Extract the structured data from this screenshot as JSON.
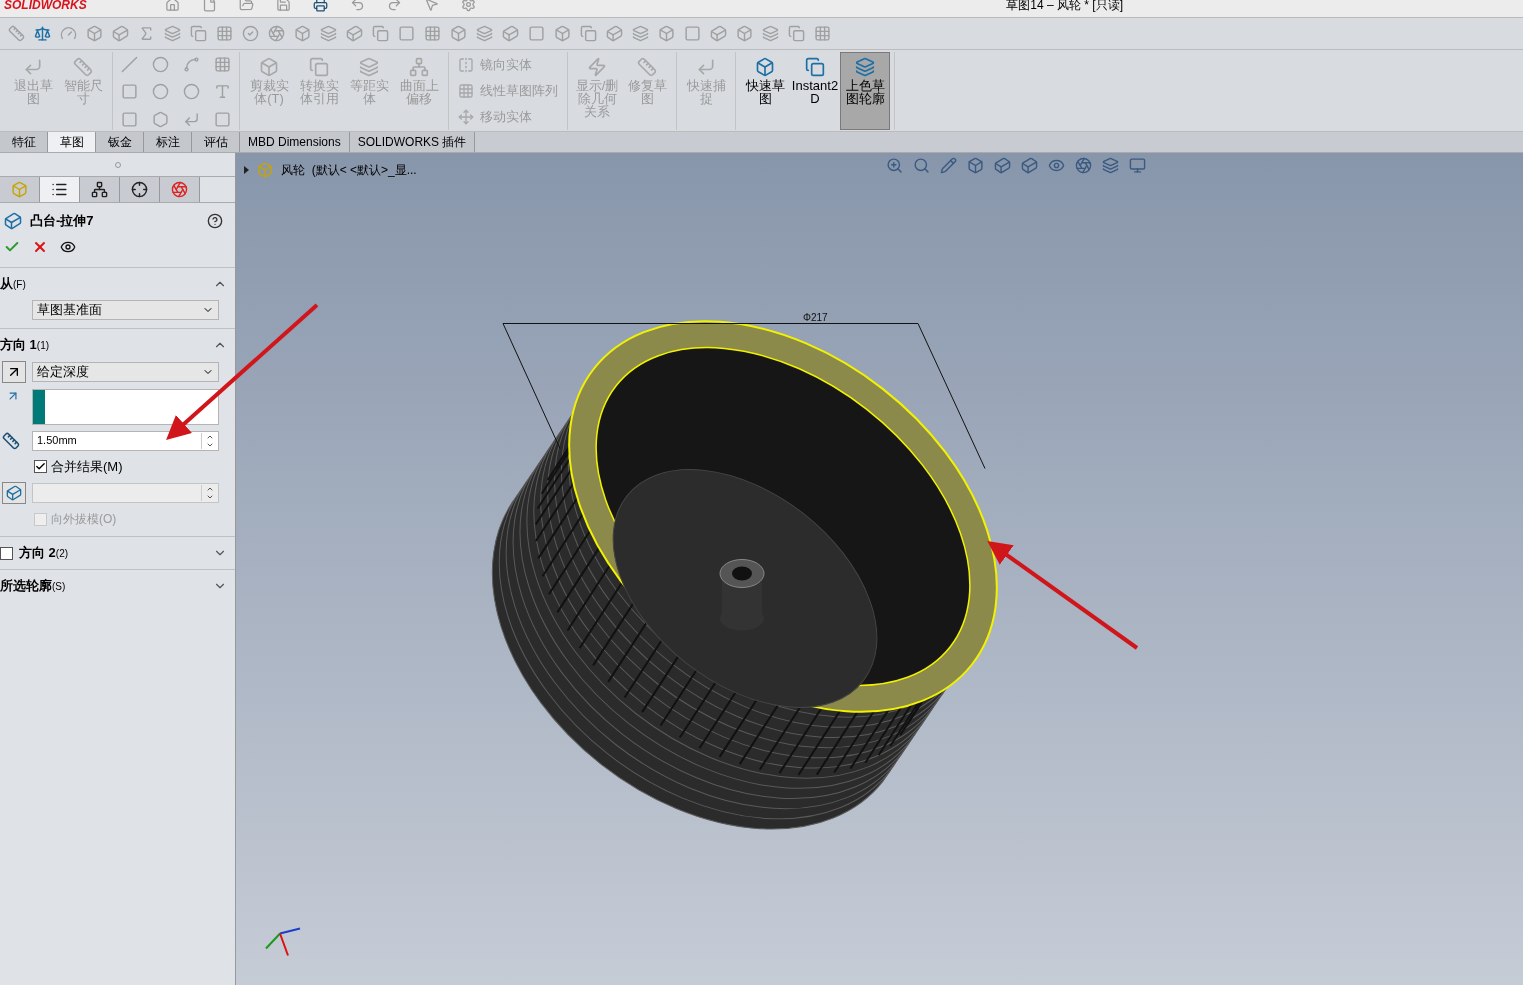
{
  "app": {
    "logo": "SOLIDWORKS",
    "title": "草图14 – 风轮 * [只读]"
  },
  "ribbon": [
    {
      "kind": "large",
      "commands": [
        {
          "label": "退出草图",
          "disabled": true,
          "selected": false
        },
        {
          "label": "智能尺寸",
          "disabled": true,
          "selected": false
        }
      ]
    },
    {
      "kind": "large",
      "commands": [
        {
          "label": "剪裁实体(T)",
          "disabled": true,
          "selected": false
        },
        {
          "label": "转换实体引用",
          "disabled": true,
          "selected": false
        },
        {
          "label": "等距实体",
          "disabled": true,
          "selected": false
        },
        {
          "label": "曲面上偏移",
          "disabled": true,
          "selected": false
        }
      ]
    },
    {
      "kind": "small",
      "commands": [
        {
          "label": "镜向实体",
          "disabled": true,
          "selected": false
        },
        {
          "label": "线性草图阵列",
          "disabled": true,
          "selected": false
        },
        {
          "label": "移动实体",
          "disabled": true,
          "selected": false
        }
      ]
    },
    {
      "kind": "large",
      "commands": [
        {
          "label": "显示/删除几何关系",
          "disabled": true,
          "selected": false
        },
        {
          "label": "修复草图",
          "disabled": true,
          "selected": false
        }
      ]
    },
    {
      "kind": "large",
      "commands": [
        {
          "label": "快速捕捉",
          "disabled": true,
          "selected": false
        }
      ]
    },
    {
      "kind": "large",
      "commands": [
        {
          "label": "快速草图",
          "disabled": false,
          "selected": false
        },
        {
          "label": "Instant2D",
          "disabled": false,
          "selected": false
        },
        {
          "label": "上色草图轮廓",
          "disabled": false,
          "selected": true
        }
      ]
    }
  ],
  "tabs": [
    {
      "label": "特征",
      "selected": false
    },
    {
      "label": "草图",
      "selected": true
    },
    {
      "label": "钣金",
      "selected": false
    },
    {
      "label": "标注",
      "selected": false
    },
    {
      "label": "评估",
      "selected": false
    },
    {
      "label": "MBD Dimensions",
      "selected": false
    },
    {
      "label": "SOLIDWORKS 插件",
      "selected": false
    }
  ],
  "panel_tabs": [
    {
      "selected": false
    },
    {
      "selected": true
    },
    {
      "selected": false
    },
    {
      "selected": false
    },
    {
      "selected": false
    }
  ],
  "feature": {
    "title": "凸台-拉伸7"
  },
  "sections": [
    {
      "kind": "from",
      "title": "从",
      "hotkey": "(F)",
      "expanded": true,
      "select": "草图基准面"
    },
    {
      "kind": "direction1",
      "title": "方向 1",
      "hotkey": "(1)",
      "expanded": true,
      "select": "给定深度",
      "depth": "1.50mm",
      "merge": {
        "label": "合并结果(M)",
        "checked": true
      },
      "draft": {
        "label": "向外拔模(O)",
        "checked": false,
        "disabled": true
      }
    },
    {
      "kind": "direction2",
      "title": "方向 2",
      "hotkey": "(2)",
      "expanded": false,
      "checked": false
    },
    {
      "kind": "contours",
      "title": "所选轮廓",
      "hotkey": "(S)",
      "expanded": false
    }
  ],
  "viewport": {
    "tree_label": "风轮  (默认< <默认>_显...",
    "dimension": "Φ217"
  }
}
